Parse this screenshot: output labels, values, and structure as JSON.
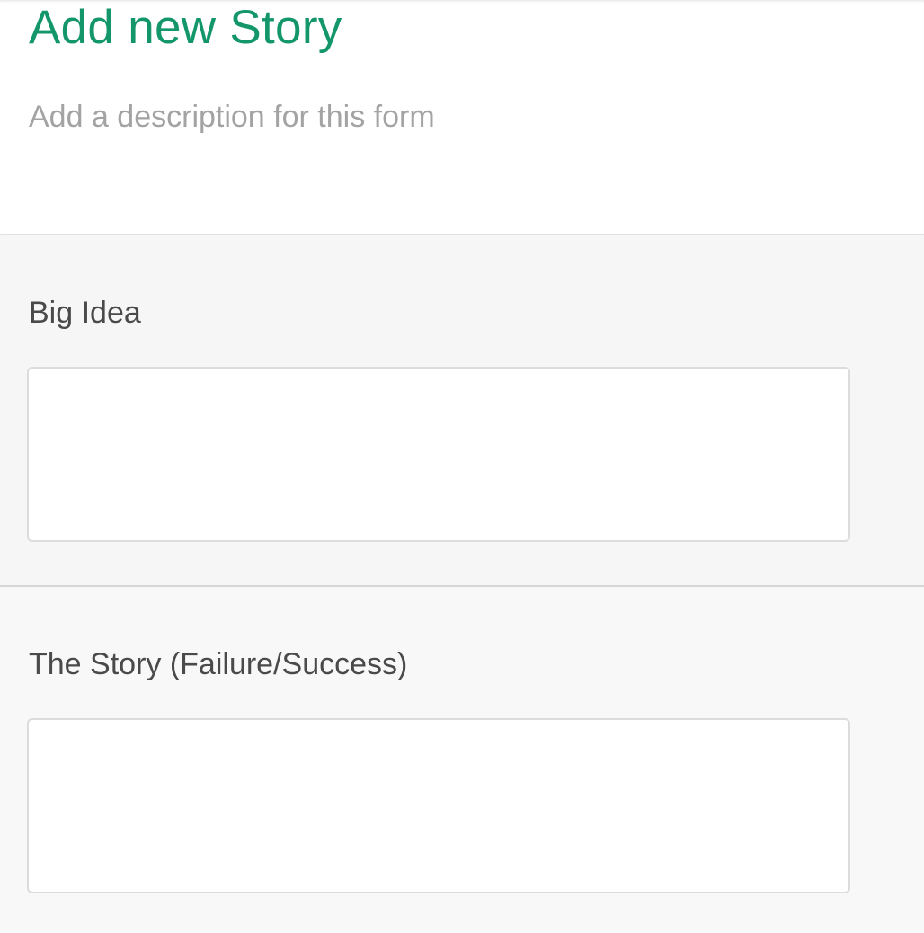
{
  "form": {
    "title": "Add new Story",
    "description": "Add a description for this form"
  },
  "fields": [
    {
      "label": "Big Idea",
      "value": ""
    },
    {
      "label": "The Story (Failure/Success)",
      "value": ""
    }
  ],
  "colors": {
    "title": "#14966b",
    "description": "#a3a3a3",
    "label": "#4a4a4a",
    "section_background": "#f6f6f6",
    "input_border": "#dcdcdc"
  }
}
